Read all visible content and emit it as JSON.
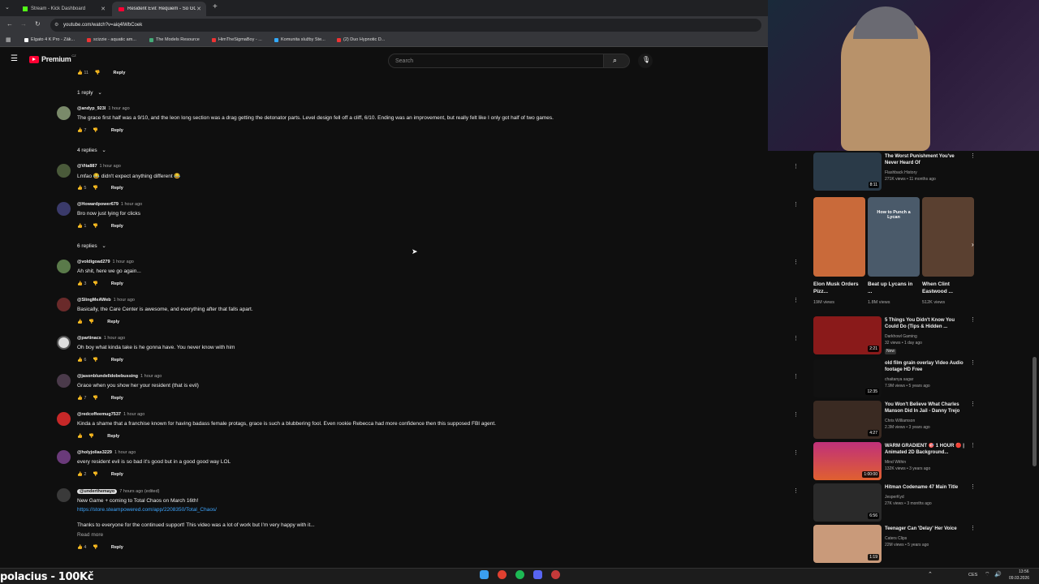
{
  "browser": {
    "tabs": [
      {
        "title": "Stream - Kick Dashboard",
        "active": false
      },
      {
        "title": "Resident Evil: Requiem - So GO...",
        "active": true
      }
    ],
    "url": "youtube.com/watch?v=aiq4lWbCoek",
    "bookmarks": [
      "Elgato 4 K Pro - Zák...",
      "scizzie - aquatic am...",
      "The Models Resource",
      "HimTheSigmaBoy - ...",
      "Komunita služby Ste...",
      "(2) Duo Hypnotic D..."
    ]
  },
  "youtube": {
    "logo_text": "Premium",
    "logo_region": "CZ",
    "search_placeholder": "Search"
  },
  "comments": [
    {
      "handle": "",
      "time": "",
      "text": "",
      "likes": "11",
      "reply_label": "Reply",
      "replies_label": "1 reply"
    },
    {
      "handle": "@andyp_923l",
      "time": "1 hour ago",
      "text": "The grace first half was a 9/10, and the leon long section was a drag getting the detonator parts. Level design fell off a cliff, 6/10. Ending was an improvement, but really felt like I only got half of two games.",
      "likes": "7",
      "reply_label": "Reply",
      "replies_label": "4 replies"
    },
    {
      "handle": "@Vita887",
      "time": "1 hour ago",
      "text": "Lmfao 😂 didn't expect anything different 😂",
      "likes": "5",
      "reply_label": "Reply"
    },
    {
      "handle": "@Howardpower679",
      "time": "1 hour ago",
      "text": "Bro now just lying for clicks",
      "likes": "1",
      "reply_label": "Reply",
      "replies_label": "6 replies"
    },
    {
      "handle": "@voldigoad279",
      "time": "1 hour ago",
      "text": "Ah shit, here we go again...",
      "likes": "3",
      "reply_label": "Reply"
    },
    {
      "handle": "@SlingMeAWeb",
      "time": "1 hour ago",
      "text": "Basically, the Care Center is awesome, and everything after that falls apart.",
      "likes": "",
      "reply_label": "Reply"
    },
    {
      "handle": "@partinacs",
      "time": "1 hour ago",
      "text": "Oh boy what kinda take is he gonna have. You never know with him",
      "likes": "6",
      "reply_label": "Reply"
    },
    {
      "handle": "@jasonblundelldobebussing",
      "time": "1 hour ago",
      "text": "Grace when you show her your resident (that is evil)",
      "likes": "7",
      "reply_label": "Reply"
    },
    {
      "handle": "@redcoffeemug7537",
      "time": "1 hour ago",
      "text": "Kinda a shame that a franchise known for having badass female protags, grace is such a blubbering fool. Even rookie Rebecca had more confidence then this supposed FBI agent.",
      "likes": "",
      "reply_label": "Reply"
    },
    {
      "handle": "@holyjolias3229",
      "time": "1 hour ago",
      "text": "every resident evil is so bad it's good but in a good good way LOL",
      "likes": "2",
      "reply_label": "Reply"
    },
    {
      "handle": "@underthemayo",
      "time": "7 hours ago (edited)",
      "text": "New Game + coming to Total Chaos on March 16th!",
      "link": "https://store.steampowered.com/app/2208350/Total_Chaos/",
      "text2": "Thanks to everyone for the continued support! This video was a lot of work but I'm very happy with it...",
      "read_more": "Read more",
      "likes": "4",
      "reply_label": "Reply"
    }
  ],
  "sidebar_videos": [
    {
      "title": "The Worst Punishment You've Never Heard Of",
      "channel": "Flashback History",
      "meta": "271K views • 11 months ago",
      "duration": "8:11",
      "thumb_color": "#2a3a48"
    },
    {
      "title": "5 Things You Didn't Know You Could Do (Tips & Hidden ...",
      "channel": "Darkhowl Gaming",
      "meta": "32 views • 1 day ago",
      "badge": "New",
      "duration": "2:21",
      "thumb_color": "#8a1a1a"
    },
    {
      "title": "old film grain overlay Video Audio footage HD Free",
      "channel": "chaitanya sagar",
      "meta": "7.9M views • 5 years ago",
      "duration": "12:35",
      "thumb_color": "#111111"
    },
    {
      "title": "You Won't Believe What Charles Manson Did In Jail - Danny Trejo",
      "channel": "Chris Williamson",
      "meta": "2.3M views • 3 years ago",
      "duration": "4:27",
      "thumb_color": "#3a2a22"
    },
    {
      "title": "WARM GRADIENT 🎯 1 HOUR 🔴 | Animated 2D Background...",
      "channel": "Mind Within",
      "meta": "132K views • 3 years ago",
      "duration": "1:00:00",
      "thumb_color": "#c0307a"
    },
    {
      "title": "Hitman Codename 47 Main Title",
      "channel": "JesperKyd",
      "meta": "27K views • 3 months ago",
      "duration": "6:56",
      "thumb_color": "#2a2a2a"
    },
    {
      "title": "Teenager Can 'Delay' Her Voice",
      "channel": "Caters Clips",
      "meta": "22M views • 5 years ago",
      "duration": "1:19",
      "thumb_color": "#c99a7a"
    }
  ],
  "shorts": [
    {
      "title": "Elon Musk Orders Pizz...",
      "views": "19M views",
      "thumb_color": "#c96a3a"
    },
    {
      "title": "Beat up Lycans in ...",
      "views": "1.8M views",
      "thumb_color": "#4a5a6a",
      "label": "How to Punch a Lycan"
    },
    {
      "title": "When Clint Eastwood ...",
      "views": "512K views",
      "thumb_color": "#5a4030"
    }
  ],
  "stream_overlay": "polacius - 100Kč",
  "system_tray": {
    "lang": "CES",
    "time": "13:56",
    "date": "09.03.2026"
  }
}
